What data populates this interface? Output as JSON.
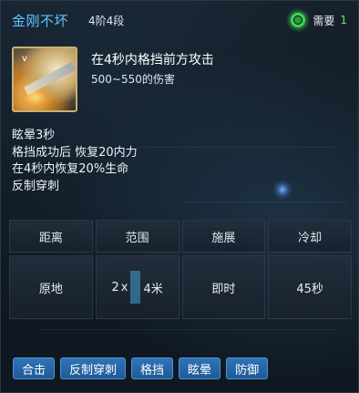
{
  "skill": {
    "name": "金刚不坏",
    "tier": "4阶4段",
    "description": "在4秒内格挡前方攻击",
    "damage": "500~550的伤害",
    "icon": "skill-icon-glowing-blade"
  },
  "requirement": {
    "label": "需要",
    "value": "1",
    "icon": "green-ring-icon"
  },
  "effects": [
    "眩晕3秒",
    "格挡成功后 恢复20内力",
    "在4秒内恢复20%生命",
    "反制穿刺"
  ],
  "stats": {
    "headers": [
      "距离",
      "范围",
      "施展",
      "冷却"
    ],
    "values": {
      "distance": "原地",
      "range_a": "2",
      "range_x": "x",
      "range_b": "4米",
      "cast": "即时",
      "cooldown": "45秒"
    }
  },
  "tags": [
    "合击",
    "反制穿刺",
    "格挡",
    "眩晕",
    "防御"
  ],
  "colors": {
    "title": "#5ec7ff",
    "requirement_value": "#6ee07a",
    "tag_bg": "#2f74b8"
  }
}
